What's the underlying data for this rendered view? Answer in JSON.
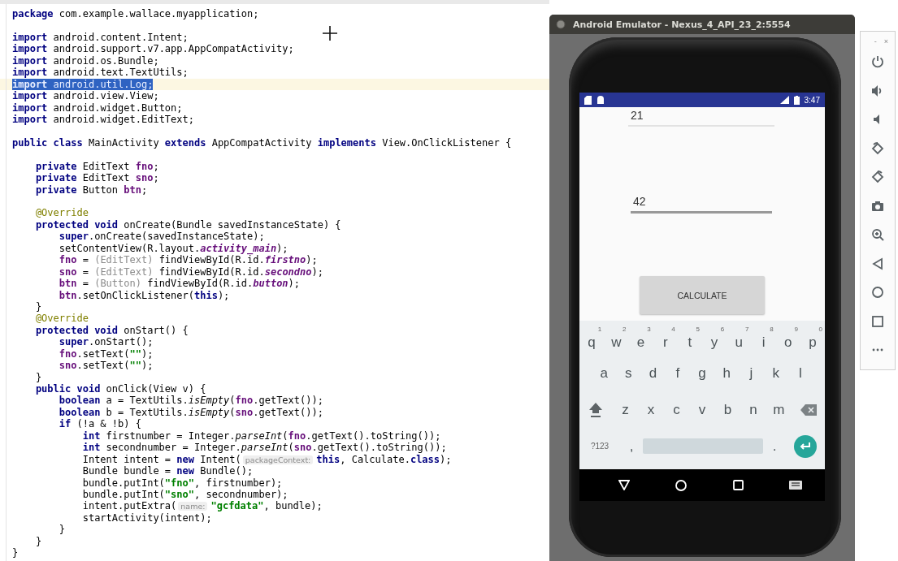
{
  "code": {
    "lines": [
      {
        "selected": false,
        "tokens": [
          {
            "kind": "keyword",
            "text": "package"
          },
          {
            "kind": "plain",
            "text": " com.example.wallace.myapplication;"
          }
        ]
      },
      {
        "selected": false
      },
      {
        "selected": false,
        "tokens": [
          {
            "kind": "keyword",
            "text": "import"
          },
          {
            "kind": "plain",
            "text": " android.content.Intent;"
          }
        ]
      },
      {
        "selected": false,
        "tokens": [
          {
            "kind": "keyword",
            "text": "import"
          },
          {
            "kind": "plain",
            "text": " android.support.v7.app.AppCompatActivity;"
          }
        ]
      },
      {
        "selected": false,
        "tokens": [
          {
            "kind": "keyword",
            "text": "import"
          },
          {
            "kind": "plain",
            "text": " android.os.Bundle;"
          }
        ]
      },
      {
        "selected": false,
        "tokens": [
          {
            "kind": "keyword",
            "text": "import"
          },
          {
            "kind": "plain",
            "text": " android.text.TextUtils;"
          }
        ]
      },
      {
        "selected": true,
        "tokens": [
          {
            "kind": "keyword",
            "text": "import"
          },
          {
            "kind": "plain",
            "text": " android.util.Log;"
          }
        ]
      },
      {
        "selected": false,
        "tokens": [
          {
            "kind": "keyword",
            "text": "import"
          },
          {
            "kind": "plain",
            "text": " android.view.View;"
          }
        ]
      },
      {
        "selected": false,
        "tokens": [
          {
            "kind": "keyword",
            "text": "import"
          },
          {
            "kind": "plain",
            "text": " android.widget.Button;"
          }
        ]
      },
      {
        "selected": false,
        "tokens": [
          {
            "kind": "keyword",
            "text": "import"
          },
          {
            "kind": "plain",
            "text": " android.widget.EditText;"
          }
        ]
      },
      {
        "selected": false
      },
      {
        "selected": false,
        "tokens": [
          {
            "kind": "keyword",
            "text": "public class"
          },
          {
            "kind": "plain",
            "text": " MainActivity "
          },
          {
            "kind": "keyword",
            "text": "extends"
          },
          {
            "kind": "plain",
            "text": " AppCompatActivity "
          },
          {
            "kind": "keyword",
            "text": "implements"
          },
          {
            "kind": "plain",
            "text": " View.OnClickListener {"
          }
        ]
      },
      {
        "selected": false
      },
      {
        "selected": false,
        "tokens": [
          {
            "kind": "keyword",
            "text": "    private"
          },
          {
            "kind": "plain",
            "text": " EditText "
          },
          {
            "kind": "field",
            "text": "fno"
          },
          {
            "kind": "plain",
            "text": ";"
          }
        ]
      },
      {
        "selected": false,
        "tokens": [
          {
            "kind": "keyword",
            "text": "    private"
          },
          {
            "kind": "plain",
            "text": " EditText "
          },
          {
            "kind": "field",
            "text": "sno"
          },
          {
            "kind": "plain",
            "text": ";"
          }
        ]
      },
      {
        "selected": false,
        "tokens": [
          {
            "kind": "keyword",
            "text": "    private"
          },
          {
            "kind": "plain",
            "text": " Button "
          },
          {
            "kind": "field",
            "text": "btn"
          },
          {
            "kind": "plain",
            "text": ";"
          }
        ]
      },
      {
        "selected": false
      },
      {
        "selected": false,
        "tokens": [
          {
            "kind": "annotation",
            "text": "    @Override"
          }
        ]
      },
      {
        "selected": false,
        "tokens": [
          {
            "kind": "keyword",
            "text": "    protected void"
          },
          {
            "kind": "plain",
            "text": " onCreate(Bundle savedInstanceState) {"
          }
        ]
      },
      {
        "selected": false,
        "tokens": [
          {
            "kind": "keyword",
            "text": "        super"
          },
          {
            "kind": "plain",
            "text": ".onCreate(savedInstanceState);"
          }
        ]
      },
      {
        "selected": false,
        "tokens": [
          {
            "kind": "plain",
            "text": "        setContentView(R.layout."
          },
          {
            "kind": "field_italic",
            "text": "activity_main"
          },
          {
            "kind": "plain",
            "text": ");"
          }
        ]
      },
      {
        "selected": false,
        "tokens": [
          {
            "kind": "field",
            "text": "        fno"
          },
          {
            "kind": "plain",
            "text": " = "
          },
          {
            "kind": "cast",
            "text": "(EditText)"
          },
          {
            "kind": "plain",
            "text": " findViewById(R.id."
          },
          {
            "kind": "field_italic",
            "text": "firstno"
          },
          {
            "kind": "plain",
            "text": ");"
          }
        ]
      },
      {
        "selected": false,
        "tokens": [
          {
            "kind": "field",
            "text": "        sno"
          },
          {
            "kind": "plain",
            "text": " = "
          },
          {
            "kind": "cast",
            "text": "(EditText)"
          },
          {
            "kind": "plain",
            "text": " findViewById(R.id."
          },
          {
            "kind": "field_italic",
            "text": "secondno"
          },
          {
            "kind": "plain",
            "text": ");"
          }
        ]
      },
      {
        "selected": false,
        "tokens": [
          {
            "kind": "field",
            "text": "        btn"
          },
          {
            "kind": "plain",
            "text": " = "
          },
          {
            "kind": "cast",
            "text": "(Button)"
          },
          {
            "kind": "plain",
            "text": " findViewById(R.id."
          },
          {
            "kind": "field_italic",
            "text": "button"
          },
          {
            "kind": "plain",
            "text": ");"
          }
        ]
      },
      {
        "selected": false,
        "tokens": [
          {
            "kind": "field",
            "text": "        btn"
          },
          {
            "kind": "plain",
            "text": ".setOnClickListener("
          },
          {
            "kind": "keyword",
            "text": "this"
          },
          {
            "kind": "plain",
            "text": ");"
          }
        ]
      },
      {
        "selected": false,
        "tokens": [
          {
            "kind": "plain",
            "text": "    }"
          }
        ]
      },
      {
        "selected": false,
        "tokens": [
          {
            "kind": "annotation",
            "text": "    @Override"
          }
        ]
      },
      {
        "selected": false,
        "tokens": [
          {
            "kind": "keyword",
            "text": "    protected void"
          },
          {
            "kind": "plain",
            "text": " onStart() {"
          }
        ]
      },
      {
        "selected": false,
        "tokens": [
          {
            "kind": "keyword",
            "text": "        super"
          },
          {
            "kind": "plain",
            "text": ".onStart();"
          }
        ]
      },
      {
        "selected": false,
        "tokens": [
          {
            "kind": "field",
            "text": "        fno"
          },
          {
            "kind": "plain",
            "text": ".setText("
          },
          {
            "kind": "string",
            "text": "\"\""
          },
          {
            "kind": "plain",
            "text": ");"
          }
        ]
      },
      {
        "selected": false,
        "tokens": [
          {
            "kind": "field",
            "text": "        sno"
          },
          {
            "kind": "plain",
            "text": ".setText("
          },
          {
            "kind": "string",
            "text": "\"\""
          },
          {
            "kind": "plain",
            "text": ");"
          }
        ]
      },
      {
        "selected": false,
        "tokens": [
          {
            "kind": "plain",
            "text": "    }"
          }
        ]
      },
      {
        "selected": false,
        "tokens": [
          {
            "kind": "keyword",
            "text": "    public void"
          },
          {
            "kind": "plain",
            "text": " onClick(View v) {"
          }
        ]
      },
      {
        "selected": false,
        "tokens": [
          {
            "kind": "keyword",
            "text": "        boolean"
          },
          {
            "kind": "plain",
            "text": " a = TextUtils."
          },
          {
            "kind": "static_method",
            "text": "isEmpty"
          },
          {
            "kind": "plain",
            "text": "("
          },
          {
            "kind": "field",
            "text": "fno"
          },
          {
            "kind": "plain",
            "text": ".getText());"
          }
        ]
      },
      {
        "selected": false,
        "tokens": [
          {
            "kind": "keyword",
            "text": "        boolean"
          },
          {
            "kind": "plain",
            "text": " b = TextUtils."
          },
          {
            "kind": "static_method",
            "text": "isEmpty"
          },
          {
            "kind": "plain",
            "text": "("
          },
          {
            "kind": "field",
            "text": "sno"
          },
          {
            "kind": "plain",
            "text": ".getText());"
          }
        ]
      },
      {
        "selected": false,
        "tokens": [
          {
            "kind": "keyword",
            "text": "        if"
          },
          {
            "kind": "plain",
            "text": " (!a & !b) {"
          }
        ]
      },
      {
        "selected": false,
        "tokens": [
          {
            "kind": "keyword",
            "text": "            int"
          },
          {
            "kind": "plain",
            "text": " firstnumber = Integer."
          },
          {
            "kind": "static_method",
            "text": "parseInt"
          },
          {
            "kind": "plain",
            "text": "("
          },
          {
            "kind": "field",
            "text": "fno"
          },
          {
            "kind": "plain",
            "text": ".getText().toString());"
          }
        ]
      },
      {
        "selected": false,
        "tokens": [
          {
            "kind": "keyword",
            "text": "            int"
          },
          {
            "kind": "plain",
            "text": " secondnumber = Integer."
          },
          {
            "kind": "static_method",
            "text": "parseInt"
          },
          {
            "kind": "plain",
            "text": "("
          },
          {
            "kind": "field",
            "text": "sno"
          },
          {
            "kind": "plain",
            "text": ".getText().toString());"
          }
        ]
      },
      {
        "selected": false,
        "tokens": [
          {
            "kind": "plain",
            "text": "            Intent intent = "
          },
          {
            "kind": "keyword",
            "text": "new"
          },
          {
            "kind": "plain",
            "text": " Intent("
          },
          {
            "kind": "hint",
            "text": "packageContext:"
          },
          {
            "kind": "keyword",
            "text": "this"
          },
          {
            "kind": "plain",
            "text": ", Calculate."
          },
          {
            "kind": "keyword",
            "text": "class"
          },
          {
            "kind": "plain",
            "text": ");"
          }
        ]
      },
      {
        "selected": false,
        "tokens": [
          {
            "kind": "plain",
            "text": "            Bundle bundle = "
          },
          {
            "kind": "keyword",
            "text": "new"
          },
          {
            "kind": "plain",
            "text": " Bundle();"
          }
        ]
      },
      {
        "selected": false,
        "tokens": [
          {
            "kind": "plain",
            "text": "            bundle.putInt("
          },
          {
            "kind": "string",
            "text": "\"fno\""
          },
          {
            "kind": "plain",
            "text": ", firstnumber);"
          }
        ]
      },
      {
        "selected": false,
        "tokens": [
          {
            "kind": "plain",
            "text": "            bundle.putInt("
          },
          {
            "kind": "string",
            "text": "\"sno\""
          },
          {
            "kind": "plain",
            "text": ", secondnumber);"
          }
        ]
      },
      {
        "selected": false,
        "tokens": [
          {
            "kind": "plain",
            "text": "            intent.putExtra("
          },
          {
            "kind": "hint",
            "text": "name:"
          },
          {
            "kind": "string",
            "text": "\"gcfdata\""
          },
          {
            "kind": "plain",
            "text": ", bundle);"
          }
        ]
      },
      {
        "selected": false,
        "tokens": [
          {
            "kind": "plain",
            "text": "            startActivity(intent);"
          }
        ]
      },
      {
        "selected": false,
        "tokens": [
          {
            "kind": "plain",
            "text": "        }"
          }
        ]
      },
      {
        "selected": false,
        "tokens": [
          {
            "kind": "plain",
            "text": "    }"
          }
        ]
      },
      {
        "selected": false,
        "tokens": [
          {
            "kind": "plain",
            "text": "}"
          }
        ]
      }
    ]
  },
  "emulator": {
    "title": "Android Emulator - Nexus_4_API_23_2:5554",
    "status_bar": {
      "time": "3:47"
    },
    "app": {
      "fields": [
        {
          "value": "21",
          "focused": false
        },
        {
          "value": "42",
          "focused": true
        }
      ],
      "button": "CALCULATE"
    },
    "keyboard": {
      "rows": [
        {
          "keys": [
            {
              "kind": "letter",
              "label": "q",
              "hint": "1"
            },
            {
              "kind": "letter",
              "label": "w",
              "hint": "2"
            },
            {
              "kind": "letter",
              "label": "e",
              "hint": "3"
            },
            {
              "kind": "letter",
              "label": "r",
              "hint": "4"
            },
            {
              "kind": "letter",
              "label": "t",
              "hint": "5"
            },
            {
              "kind": "letter",
              "label": "y",
              "hint": "6"
            },
            {
              "kind": "letter",
              "label": "u",
              "hint": "7"
            },
            {
              "kind": "letter",
              "label": "i",
              "hint": "8"
            },
            {
              "kind": "letter",
              "label": "o",
              "hint": "9"
            },
            {
              "kind": "letter",
              "label": "p",
              "hint": "0"
            }
          ]
        },
        {
          "keys": [
            {
              "kind": "letter",
              "label": "a"
            },
            {
              "kind": "letter",
              "label": "s"
            },
            {
              "kind": "letter",
              "label": "d"
            },
            {
              "kind": "letter",
              "label": "f"
            },
            {
              "kind": "letter",
              "label": "g"
            },
            {
              "kind": "letter",
              "label": "h"
            },
            {
              "kind": "letter",
              "label": "j"
            },
            {
              "kind": "letter",
              "label": "k"
            },
            {
              "kind": "letter",
              "label": "l"
            }
          ]
        },
        {
          "keys": [
            {
              "kind": "shift"
            },
            {
              "kind": "letter",
              "label": "z"
            },
            {
              "kind": "letter",
              "label": "x"
            },
            {
              "kind": "letter",
              "label": "c"
            },
            {
              "kind": "letter",
              "label": "v"
            },
            {
              "kind": "letter",
              "label": "b"
            },
            {
              "kind": "letter",
              "label": "n"
            },
            {
              "kind": "letter",
              "label": "m"
            },
            {
              "kind": "backspace"
            }
          ]
        },
        {
          "keys": [
            {
              "kind": "symbols",
              "label": "?123"
            },
            {
              "kind": "punct",
              "label": ","
            },
            {
              "kind": "space"
            },
            {
              "kind": "punct",
              "label": "."
            },
            {
              "kind": "enter"
            }
          ]
        }
      ]
    }
  },
  "toolbar": {
    "minimize": "-",
    "close": "×"
  }
}
